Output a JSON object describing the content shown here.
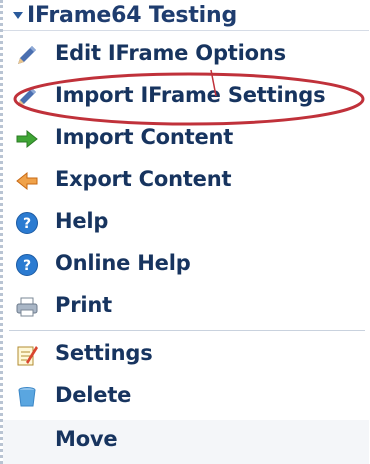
{
  "menu": {
    "title": "IFrame64 Testing",
    "items": [
      {
        "label": "Edit IFrame Options",
        "icon": "pencil-icon"
      },
      {
        "label": "Import IFrame Settings",
        "icon": "pencil-icon"
      },
      {
        "label": "Import Content",
        "icon": "import-arrow-icon"
      },
      {
        "label": "Export Content",
        "icon": "export-arrow-icon"
      },
      {
        "label": "Help",
        "icon": "help-icon"
      },
      {
        "label": "Online Help",
        "icon": "help-icon"
      },
      {
        "label": "Print",
        "icon": "print-icon"
      },
      {
        "label": "Settings",
        "icon": "settings-icon"
      },
      {
        "label": "Delete",
        "icon": "trash-icon"
      },
      {
        "label": "Move",
        "icon": ""
      }
    ]
  },
  "colors": {
    "text": "#17345f",
    "highlight_oval": "#c0313a",
    "import_arrow": "#3fa535",
    "export_arrow": "#e07c1f",
    "help": "#2b7bd1"
  }
}
